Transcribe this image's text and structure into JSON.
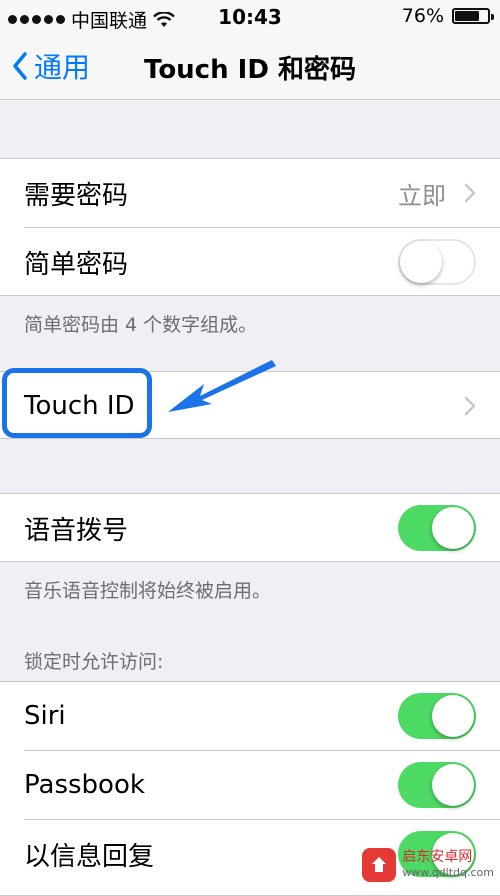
{
  "status": {
    "carrier": "中国联通",
    "time": "10:43",
    "battery": "76%",
    "battery_level": 0.76
  },
  "nav": {
    "back_label": "通用",
    "title": "Touch ID 和密码"
  },
  "passcode_group": {
    "require": {
      "label": "需要密码",
      "value": "立即"
    },
    "simple": {
      "label": "简单密码",
      "toggle": "off"
    },
    "footer": "简单密码由 4 个数字组成。"
  },
  "touch_id": {
    "label": "Touch ID"
  },
  "voice_dial": {
    "label": "语音拨号",
    "toggle": "on",
    "footer": "音乐语音控制将始终被启用。"
  },
  "lock_access": {
    "header": "锁定时允许访问:",
    "items": [
      {
        "label": "Siri",
        "toggle": "on"
      },
      {
        "label": "Passbook",
        "toggle": "on"
      },
      {
        "label": "以信息回复",
        "toggle": "on"
      }
    ]
  },
  "watermark": {
    "name": "启东安卓网",
    "url": "www.qdltdq.com"
  },
  "colors": {
    "accent": "#007aff",
    "toggle_on": "#4cd964",
    "highlight": "#1a73e8"
  }
}
